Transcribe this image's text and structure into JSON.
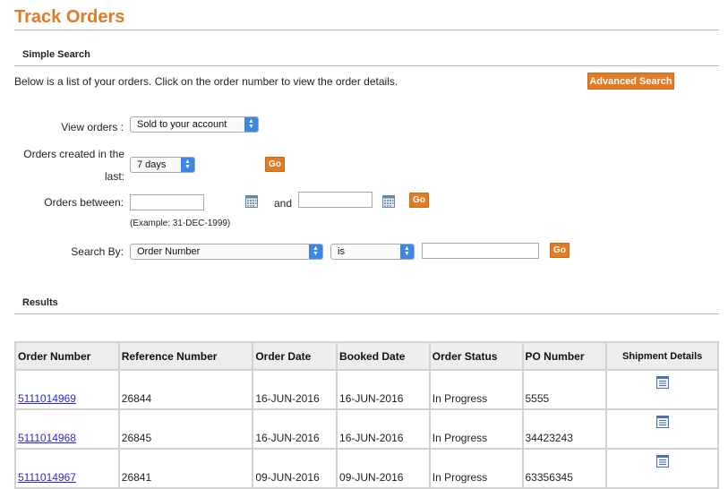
{
  "page": {
    "title": "Track Orders"
  },
  "simple_search": {
    "heading": "Simple Search",
    "intro": "Below is a list of your orders. Click on the order number to view the order details.",
    "advanced_search_label": "Advanced Search"
  },
  "form": {
    "view_orders_label": "View orders :",
    "view_orders_value": "Sold to your account",
    "created_label_line1": "Orders created in the",
    "created_label_line2": "last:",
    "created_value": "7 days",
    "go_label": "Go",
    "between_label": "Orders between:",
    "and_label": "and",
    "example": "(Example: 31-DEC-1999)",
    "search_by_label": "Search By:",
    "search_by_value": "Order Number",
    "operator_value": "is"
  },
  "results": {
    "heading": "Results",
    "columns": [
      "Order Number",
      "Reference Number",
      "Order Date",
      "Booked Date",
      "Order Status",
      "PO Number",
      "Shipment Details"
    ],
    "rows": [
      {
        "order_number": "5111014969",
        "reference": "26844",
        "order_date": "16-JUN-2016",
        "booked_date": "16-JUN-2016",
        "status": "In Progress",
        "po": "5555"
      },
      {
        "order_number": "5111014968",
        "reference": "26845",
        "order_date": "16-JUN-2016",
        "booked_date": "16-JUN-2016",
        "status": "In Progress",
        "po": "34423243"
      },
      {
        "order_number": "5111014967",
        "reference": "26841",
        "order_date": "09-JUN-2016",
        "booked_date": "09-JUN-2016",
        "status": "In Progress",
        "po": "63356345"
      }
    ]
  },
  "colors": {
    "accent": "#e07b26",
    "link": "#2a2ac8",
    "select_arrow": "#3a87e8"
  }
}
